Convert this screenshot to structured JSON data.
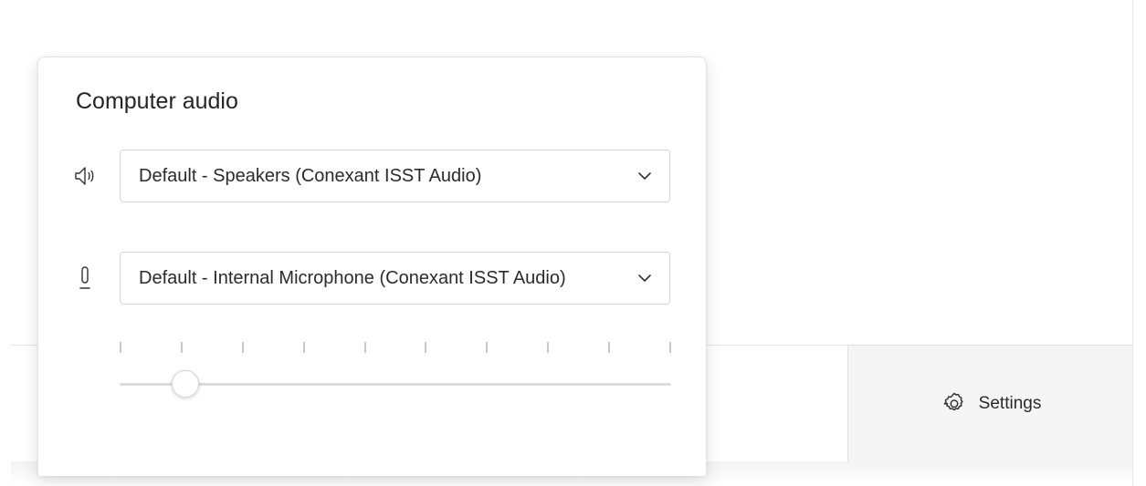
{
  "popover": {
    "title": "Computer audio",
    "speaker": {
      "icon": "speaker-icon",
      "selected": "Default - Speakers (Conexant ISST Audio)"
    },
    "microphone": {
      "icon": "microphone-icon",
      "selected": "Default - Internal Microphone (Conexant ISST Audio)"
    },
    "mic_level": {
      "value": 0.12,
      "tick_count": 10
    }
  },
  "toolbar": {
    "settings": {
      "icon": "gear-icon",
      "label": "Settings"
    }
  }
}
